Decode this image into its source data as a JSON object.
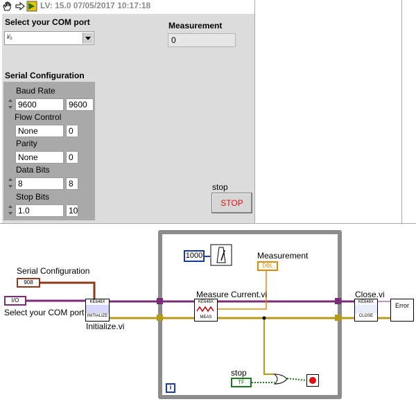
{
  "toolbar": {
    "version_text": "LV: 15.0 07/05/2017 10:17:18"
  },
  "front_panel": {
    "com_port": {
      "label": "Select your COM port",
      "io_prefix": "I/O",
      "value": ""
    },
    "measurement": {
      "label": "Measurement",
      "value": "0"
    },
    "serial_config": {
      "label": "Serial Configuration",
      "baud_rate": {
        "label": "Baud Rate",
        "value": "9600",
        "numeric": "9600"
      },
      "flow_control": {
        "label": "Flow Control",
        "value": "None",
        "numeric": "0"
      },
      "parity": {
        "label": "Parity",
        "value": "None",
        "numeric": "0"
      },
      "data_bits": {
        "label": "Data Bits",
        "value": "8",
        "numeric": "8"
      },
      "stop_bits": {
        "label": "Stop Bits",
        "value": "1.0",
        "numeric": "10"
      }
    },
    "stop": {
      "label": "stop",
      "button_text": "STOP"
    }
  },
  "block_diagram": {
    "serial_config_terminal": {
      "label": "Serial Configuration",
      "type": "908"
    },
    "com_port_terminal": {
      "label": "Select your COM port",
      "type": "I/O"
    },
    "initialize": {
      "label": "Initialize.vi",
      "icon_top": "KE648X",
      "icon_bottom": "INITIALIZE"
    },
    "wait_constant": "1000",
    "measurement_terminal": {
      "label": "Measurement",
      "type": "DBL"
    },
    "measure_current": {
      "label": "Measure Current.vi",
      "icon_top": "KE648X",
      "icon_bottom": "MEAS"
    },
    "close": {
      "label": "Close.vi",
      "icon_top": "KE648X",
      "icon_bottom": "CLOSE"
    },
    "error_handler": {
      "text": "Error"
    },
    "stop_terminal": {
      "label": "stop",
      "type": "TF"
    },
    "iteration": "i"
  }
}
